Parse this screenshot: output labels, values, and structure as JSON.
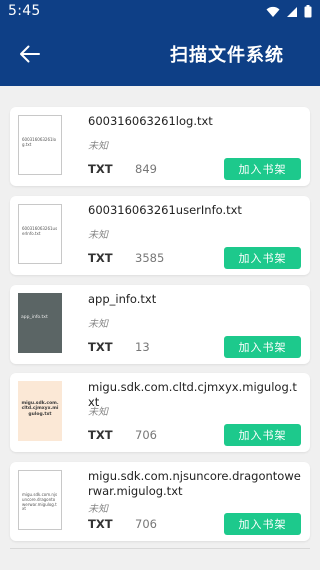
{
  "status_bar": {
    "time": "5:45"
  },
  "header": {
    "title": "扫描文件系统",
    "back_icon": "arrow-left-icon"
  },
  "files": [
    {
      "name": "600316063261log.txt",
      "thumb_text": "600316063261log.txt",
      "author": "未知",
      "type": "TXT",
      "size": "849",
      "button": "加入书架"
    },
    {
      "name": "600316063261userInfo.txt",
      "thumb_text": "600316063261userInfo.txt",
      "author": "未知",
      "type": "TXT",
      "size": "3585",
      "button": "加入书架"
    },
    {
      "name": "app_info.txt",
      "thumb_text": "app_info.txt",
      "author": "未知",
      "type": "TXT",
      "size": "13",
      "button": "加入书架"
    },
    {
      "name": "migu.sdk.com.cltd.cjmxyx.migulog.txt",
      "thumb_text": "migu.sdk.com.cltd.cjmxyx.migulog.txt",
      "author": "未知",
      "type": "TXT",
      "size": "706",
      "button": "加入书架"
    },
    {
      "name": "migu.sdk.com.njsuncore.dragontowerwar.migulog.txt",
      "thumb_text": "migu.sdk.com.njsuncore.dragontowerwar.migulog.txt",
      "author": "未知",
      "type": "TXT",
      "size": "706",
      "button": "加入书架"
    }
  ],
  "colors": {
    "header_bg": "#0e3f86",
    "button_bg": "#1dc98c",
    "page_bg": "#f0f0f0"
  }
}
